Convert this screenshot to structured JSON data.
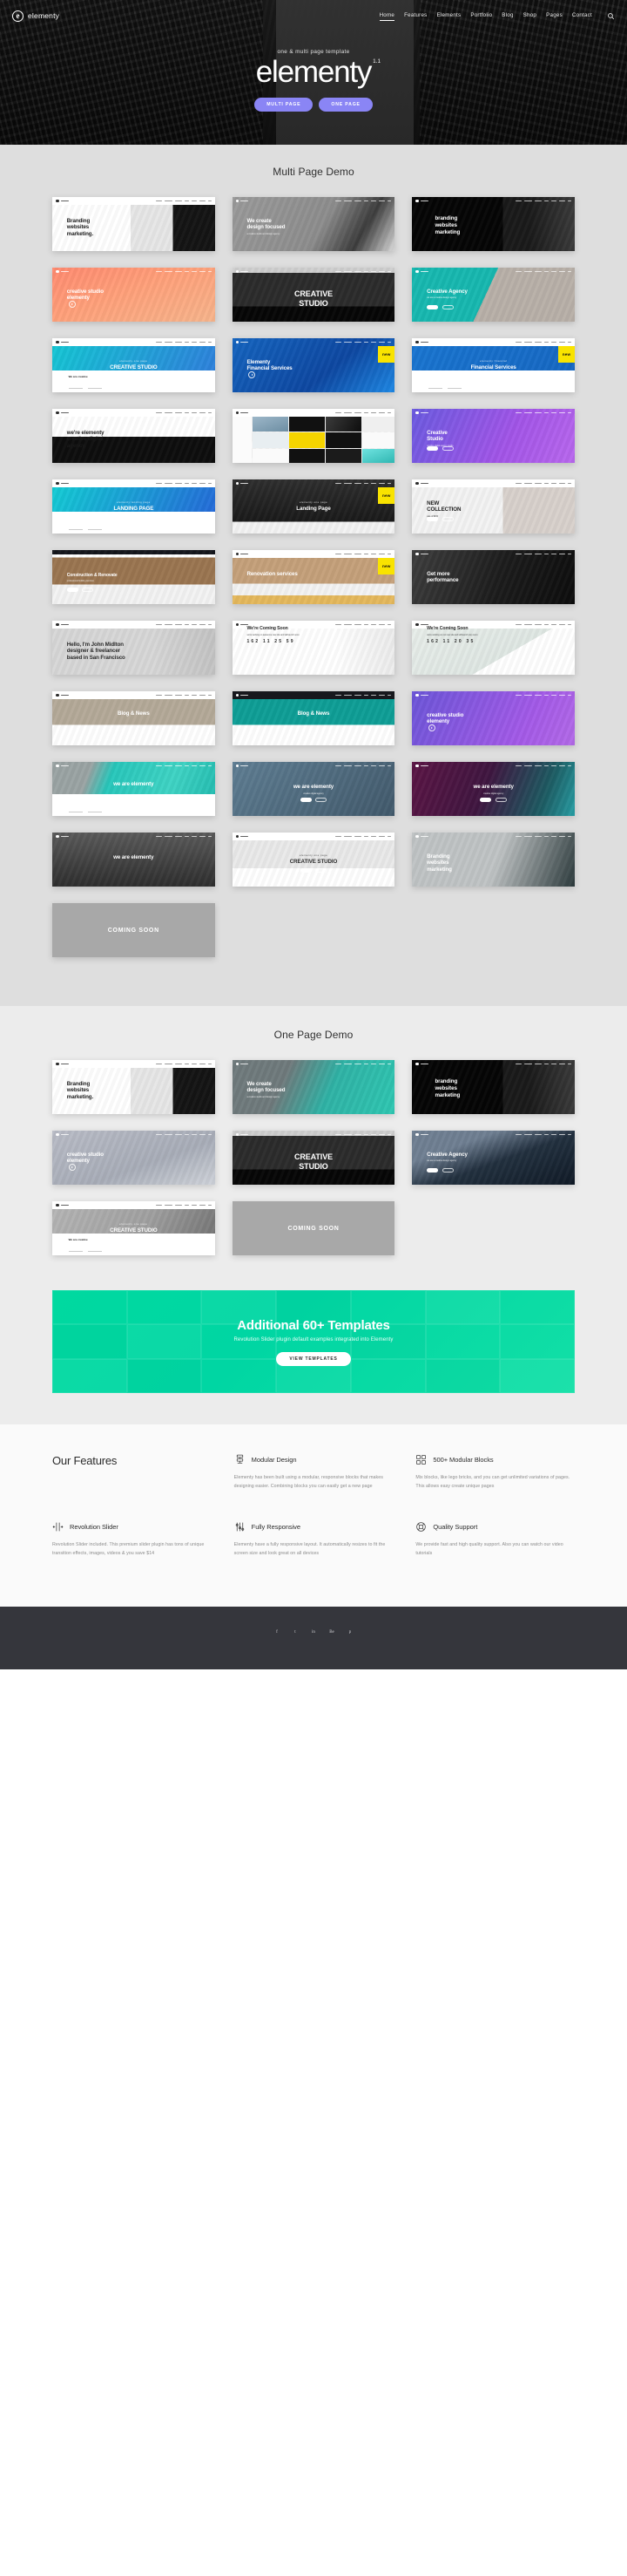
{
  "header": {
    "brand_mark": "e",
    "brand_name": "elementy",
    "nav": [
      {
        "label": "Home",
        "active": true
      },
      {
        "label": "Features",
        "active": false
      },
      {
        "label": "Elements",
        "active": false
      },
      {
        "label": "Portfolio",
        "active": false
      },
      {
        "label": "Blog",
        "active": false
      },
      {
        "label": "Shop",
        "active": false
      },
      {
        "label": "Pages",
        "active": false
      },
      {
        "label": "Contact",
        "active": false
      }
    ],
    "search_icon": "search-icon"
  },
  "hero": {
    "kicker": "one & multi page template",
    "title": "elementy",
    "version": "1.1",
    "btn_multi": "MULTI PAGE",
    "btn_one": "ONE PAGE",
    "accent": "#8a85f5"
  },
  "multi_page": {
    "title": "Multi Page Demo",
    "cards": [
      {
        "id": "branding-websites-marketing-light",
        "line1": "Branding",
        "line2": "websites",
        "line3": "marketing.",
        "style": "light-product"
      },
      {
        "id": "we-create-design-focused",
        "line1": "We create",
        "line2": "design focused",
        "sub": "a creative studio and design agency",
        "style": "grey-tunnel"
      },
      {
        "id": "branding-websites-marketing-dark",
        "line1": "branding",
        "line2": "websites",
        "line3": "marketing",
        "style": "dark-portrait"
      },
      {
        "id": "creative-studio-elementy-orange",
        "line1": "creative studio",
        "line2": "elementy",
        "style": "orange-bridge",
        "has_play": true
      },
      {
        "id": "creative-studio-script",
        "line1": "CREATIVE",
        "line2": "STUDIO",
        "style": "bw-street"
      },
      {
        "id": "creative-agency-teal",
        "line1": "Creative Agency",
        "sub": "we are a creative design agency",
        "style": "teal-frame"
      },
      {
        "id": "creative-studio-blue",
        "kicker": "elementy one page",
        "line1": "CREATIVE STUDIO",
        "style": "blue-gradient",
        "lower": "We are creative"
      },
      {
        "id": "elementy-financial-services",
        "line1": "Elementy",
        "line2": "Financial Services",
        "style": "blue-people",
        "badge": "new",
        "has_play": true
      },
      {
        "id": "financial-services-blue",
        "kicker": "elementy financial",
        "line1": "Financial Services",
        "style": "blue-people-light",
        "badge": "new"
      },
      {
        "id": "were-elementy-creative-digital-agency",
        "line1": "we're elementy",
        "line2": "creative digital",
        "line3": "agency.",
        "style": "white-agency"
      },
      {
        "id": "portfolio-masonry",
        "style": "masonry-grid"
      },
      {
        "id": "creative-studio-purple",
        "line1": "Creative",
        "line2": "Studio",
        "sub": "creative digital agency studio",
        "style": "purple-devices"
      },
      {
        "id": "landing-page-teal",
        "kicker": "elementy landing page",
        "line1": "LANDING PAGE",
        "style": "teal-dashboard"
      },
      {
        "id": "landing-page-dark",
        "kicker": "elementy one page",
        "line1": "Landing Page",
        "style": "dark-building",
        "badge": "new"
      },
      {
        "id": "new-collection-shop",
        "line1": "NEW",
        "line2": "COLLECTION",
        "sub": "sale of $150",
        "style": "shop-model"
      },
      {
        "id": "construction-renovate",
        "line1": "Construction & Renovate",
        "sub": "professional building services",
        "style": "brown-construction"
      },
      {
        "id": "renovation-services",
        "line1": "Renovation services",
        "style": "renovation",
        "badge": "new"
      },
      {
        "id": "get-more-performance",
        "line1": "Get more",
        "line2": "performance",
        "style": "car-dark"
      },
      {
        "id": "hello-im-john-midlton",
        "line1": "Hello, I'm John Midlton",
        "line2": "designer & freelancer",
        "line3": "based in San Francisco",
        "style": "grey-personal"
      },
      {
        "id": "were-coming-soon-light",
        "line1": "We're Coming Soon",
        "sub": "we're working on awesome new site and will launch soon",
        "counter": [
          "162",
          "11",
          "25",
          "59"
        ],
        "style": "coming-soon-light"
      },
      {
        "id": "were-coming-soon-map",
        "line1": "We're Coming Soon",
        "sub": "we're working on our new site and will launch very soon",
        "counter": [
          "162",
          "11",
          "20",
          "35"
        ],
        "style": "coming-soon-map"
      },
      {
        "id": "blog-and-news-mountain",
        "line1": "Blog & News",
        "style": "blog-mountain"
      },
      {
        "id": "blog-and-news-ocean",
        "line1": "Blog & News",
        "style": "blog-ocean"
      },
      {
        "id": "creative-studio-elementy-purple",
        "line1": "creative studio",
        "line2": "elementy",
        "style": "purple-office",
        "has_play": true
      },
      {
        "id": "we-are-elementy-teal",
        "line1": "we are elementy",
        "style": "teal-wire"
      },
      {
        "id": "we-are-elementy-blue",
        "line1": "we are elementy",
        "sub": "creative digital agency",
        "style": "blue-stairs"
      },
      {
        "id": "we-are-elementy-purple",
        "line1": "we are elementy",
        "sub": "creative digital agency",
        "style": "purple-prism"
      },
      {
        "id": "we-are-elementy-escalator",
        "line1": "we are elementy",
        "style": "bw-escalator"
      },
      {
        "id": "creative-studio-white-bridge",
        "kicker": "elementy one page",
        "line1": "CREATIVE STUDIO",
        "style": "white-bridge"
      },
      {
        "id": "branding-websites-marketing-building",
        "line1": "Branding",
        "line2": "websites",
        "line3": "marketing",
        "style": "grey-building"
      },
      {
        "id": "coming-soon-placeholder",
        "line1": "COMING SOON",
        "style": "coming-soon"
      }
    ]
  },
  "one_page": {
    "title": "One Page Demo",
    "cards": [
      {
        "id": "op-branding-websites-marketing",
        "line1": "Branding",
        "line2": "websites",
        "line3": "marketing.",
        "style": "light-product"
      },
      {
        "id": "op-we-create-design-focused",
        "line1": "We create",
        "line2": "design focused",
        "sub": "a creative studio and design agency",
        "style": "teal-city"
      },
      {
        "id": "op-branding-websites-marketing-dark",
        "line1": "branding",
        "line2": "websites",
        "line3": "marketing",
        "style": "dark-portrait"
      },
      {
        "id": "op-creative-studio-elementy",
        "line1": "creative studio",
        "line2": "elementy",
        "style": "climber",
        "has_play": true
      },
      {
        "id": "op-creative-studio-script",
        "line1": "CREATIVE",
        "line2": "STUDIO",
        "style": "bw-street"
      },
      {
        "id": "op-creative-agency-ocean",
        "line1": "Creative Agency",
        "sub": "we are a creative design agency",
        "style": "ocean-night"
      },
      {
        "id": "op-creative-studio-tunnel",
        "kicker": "elementy one page",
        "line1": "CREATIVE STUDIO",
        "style": "grey-tunnel-lower",
        "lower": "We are creative"
      },
      {
        "id": "op-coming-soon",
        "line1": "COMING SOON",
        "style": "coming-soon"
      }
    ]
  },
  "promo": {
    "title": "Additional 60+ Templates",
    "subtitle": "Revolution Slider plugin default examples integrated into Elementy",
    "button": "VIEW TEMPLATES",
    "accent": "#00d6a3"
  },
  "features": {
    "title": "Our Features",
    "items": [
      {
        "icon": "modular-design-icon",
        "name": "Modular Design",
        "desc": "Elementy has been built using a modular, responsive blocks that makes designing easier. Combining blocks you can easily get a new page"
      },
      {
        "icon": "blocks-grid-icon",
        "name": "500+ Modular Blocks",
        "desc": "Mix blocks, like lego bricks, and you can get unlimited variations of pages. This allows easy create unique pages"
      },
      {
        "icon": "slider-arrows-icon",
        "name": "Revolution Slider",
        "desc": "Revolution Slider included. This premium slider plugin has tons of unique transition effects, images, videos & you save $14"
      },
      {
        "icon": "sliders-icon",
        "name": "Fully Responsive",
        "desc": "Elementy have a fully responsive layout. It automatically resizes to fit the screen size and look great on all devices"
      },
      {
        "icon": "lifebuoy-icon",
        "name": "Quality Support",
        "desc": "We provide fast and high quality support. Also you can watch our video tutorials"
      }
    ]
  },
  "footer": {
    "social": [
      {
        "name": "facebook-icon",
        "glyph": "f"
      },
      {
        "name": "twitter-icon",
        "glyph": "t"
      },
      {
        "name": "linkedin-icon",
        "glyph": "in"
      },
      {
        "name": "behance-icon",
        "glyph": "Be"
      },
      {
        "name": "pinterest-icon",
        "glyph": "p"
      }
    ]
  }
}
